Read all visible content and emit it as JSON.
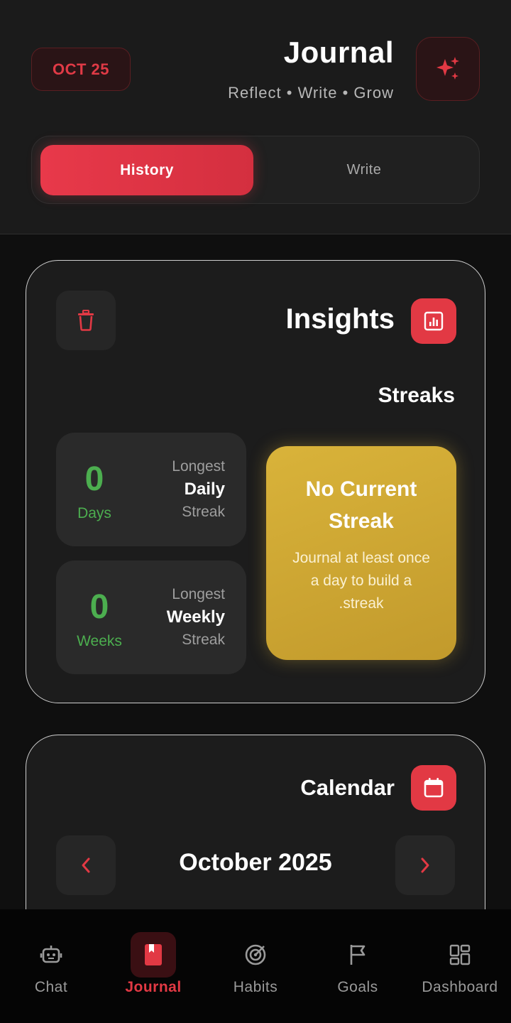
{
  "header": {
    "date_badge": "OCT 25",
    "title": "Journal",
    "subtitle": "Reflect • Write • Grow",
    "tabs": {
      "active": "History",
      "inactive": "Write"
    }
  },
  "insights": {
    "title": "Insights",
    "section": "Streaks",
    "daily": {
      "value": "0",
      "unit": "Days",
      "line1": "Longest",
      "line2": "Daily",
      "line3": "Streak"
    },
    "weekly": {
      "value": "0",
      "unit": "Weeks",
      "line1": "Longest",
      "line2": "Weekly",
      "line3": "Streak"
    },
    "current": {
      "title": "No Current Streak",
      "text": "Journal at least once a day to build a .streak"
    }
  },
  "calendar": {
    "title": "Calendar",
    "month": "October 2025"
  },
  "nav": {
    "items": [
      {
        "label": "Chat",
        "icon": "robot-icon"
      },
      {
        "label": "Journal",
        "icon": "book-icon"
      },
      {
        "label": "Habits",
        "icon": "target-icon"
      },
      {
        "label": "Goals",
        "icon": "flag-icon"
      },
      {
        "label": "Dashboard",
        "icon": "grid-icon"
      }
    ],
    "active_index": 1
  },
  "colors": {
    "accent": "#e23944",
    "streak_gold": "#d4ae37",
    "stat_green": "#4cae4f",
    "background": "#0f0f0f",
    "card": "#1c1c1c"
  }
}
